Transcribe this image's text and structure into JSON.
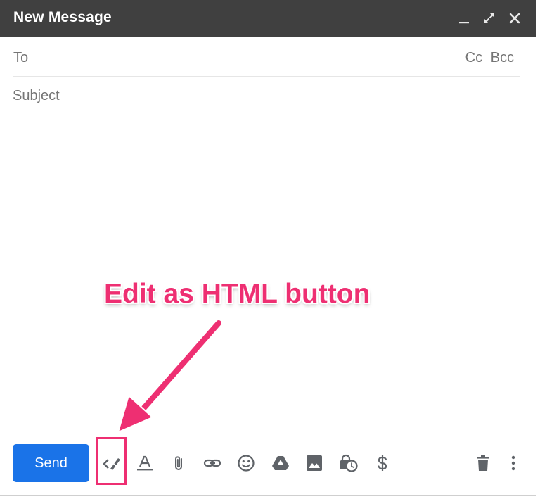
{
  "window": {
    "title": "New Message",
    "controls": [
      "minimize-icon",
      "expand-icon",
      "close-icon"
    ]
  },
  "recipients": {
    "to_label": "To",
    "to_value": "",
    "cc_label": "Cc",
    "bcc_label": "Bcc"
  },
  "subject": {
    "placeholder": "Subject",
    "value": ""
  },
  "body": {
    "value": ""
  },
  "annotation": {
    "text": "Edit as HTML button",
    "color": "#ee2f72"
  },
  "toolbar": {
    "send_label": "Send",
    "send_color": "#1a73e8",
    "tools": [
      "edit-as-html-icon",
      "formatting-options-icon",
      "attach-files-icon",
      "insert-link-icon",
      "insert-emoji-icon",
      "insert-drive-icon",
      "insert-photo-icon",
      "confidential-mode-icon",
      "send-money-icon",
      "discard-draft-icon",
      "more-options-icon"
    ]
  },
  "colors": {
    "titlebar": "#404040",
    "icon_gray": "#5f6368",
    "label_gray": "#757575"
  }
}
